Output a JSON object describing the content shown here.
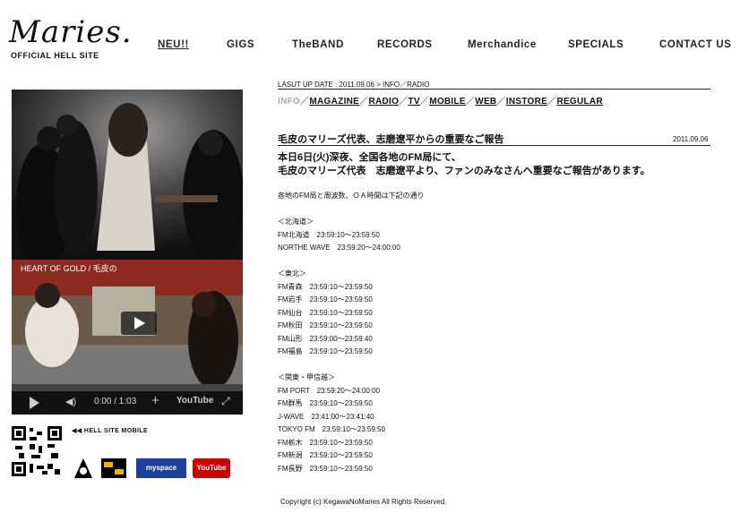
{
  "logo": {
    "script": "Maries.",
    "sub": "OFFICIAL HELL SITE"
  },
  "nav": [
    "NEU!!",
    "GIGS",
    "TheBAND",
    "RECORDS",
    "Merchandice",
    "SPECIALS",
    "CONTACT US"
  ],
  "video": {
    "title": "HEART OF GOLD / 毛皮の",
    "time": "0:00 / 1:03",
    "youtube": "YouTube"
  },
  "mobile_link": "◀◀ HELL SITE MOBILE",
  "badges": [
    "myspace",
    "YouTube"
  ],
  "lastup": "LASUT UP DATE : 2011.09.06 > INFO／RADIO",
  "categories": {
    "current": "INFO",
    "items": [
      "MAGAZINE",
      "RADIO",
      "TV",
      "MOBILE",
      "WEB",
      "INSTORE",
      "REGULAR"
    ]
  },
  "article": {
    "title": "毛皮のマリーズ代表、志磨遼平からの重要なご報告",
    "date": "2011.09.06",
    "lead": [
      "本日6日(火)深夜、全国各地のFM局にて、",
      "毛皮のマリーズ代表　志磨遼平より、ファンのみなさんへ重要なご報告があります。"
    ],
    "body": [
      "各地のFM局と周波数、ＯＡ時間は下記の通り",
      "",
      "＜北海道＞",
      "FM北海道　23:59:10〜23:59:50",
      "NORTHE WAVE　23:59:20〜24:00:00",
      "",
      "＜東北＞",
      "FM青森　23:59:10〜23:59:50",
      "FM岩手　23:59:10〜23:59:50",
      "FM仙台　23:59:10〜23:59:50",
      "FM秋田　23:59:10〜23:59:50",
      "FM山形　23:59:00〜23:59:40",
      "FM福島　23:59:10〜23:59:50",
      "",
      "＜関東・甲信越＞",
      "FM PORT　23:59:20〜24:00:00",
      "FM群馬　23:59:10〜23:59:50",
      "J-WAVE　23:41:00〜23:41:40",
      "TOKYO FM　23:59:10〜23:59:50",
      "FM栃木　23:59:10〜23:59:50",
      "FM新潟　23:59:10〜23:59:50",
      "FM長野　23:59:10〜23:59:50"
    ]
  },
  "footer": "Copyright (c) KegawaNoMaries All Rights Reserved.",
  "colors": {
    "accent": "#111111",
    "muted": "#aaaaaa",
    "youtube_red": "#cc0000",
    "myspace_blue": "#1f3f9a"
  }
}
